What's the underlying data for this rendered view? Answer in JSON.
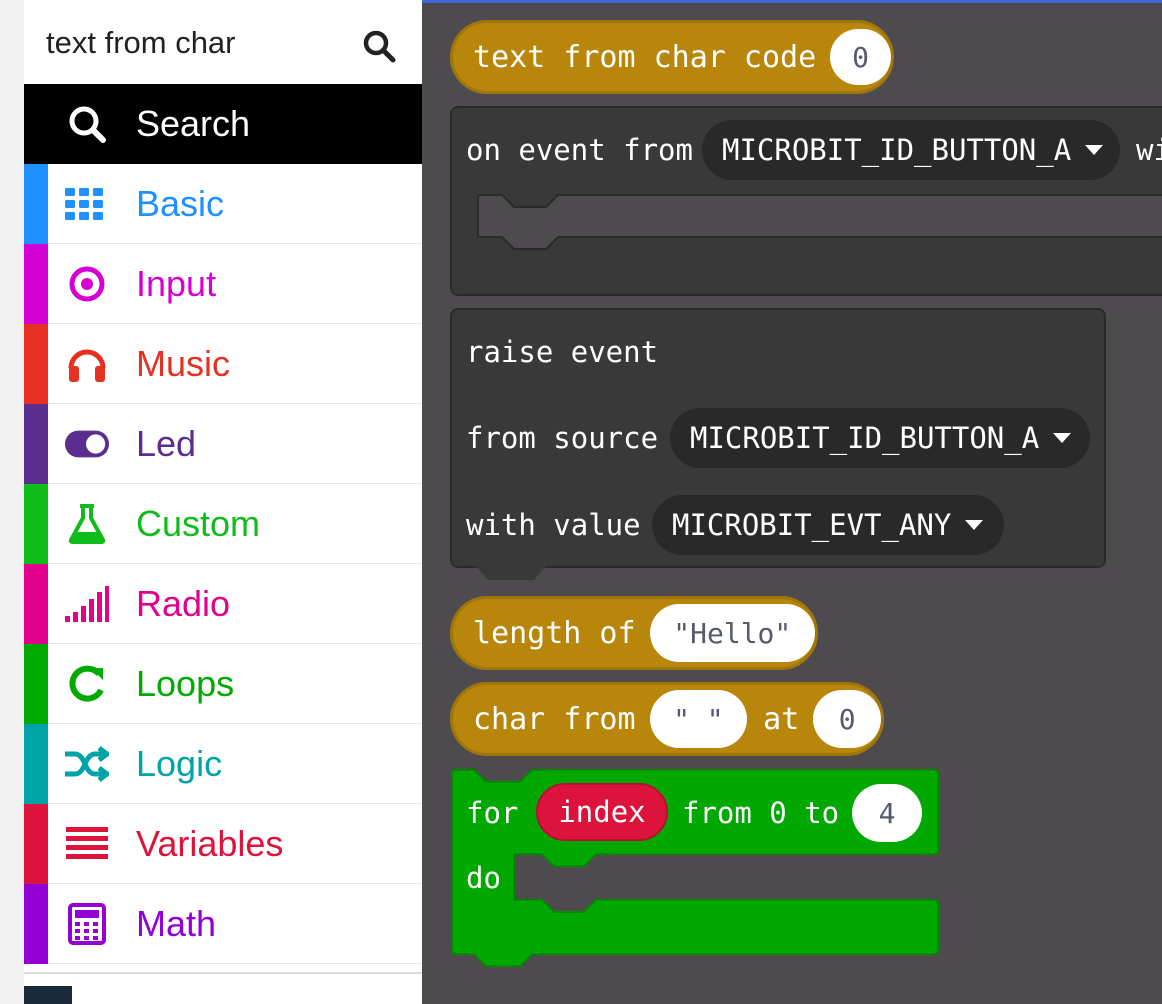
{
  "search": {
    "value": "text from char"
  },
  "categories": [
    {
      "label": "Search",
      "color": "#000000",
      "icon": "search-icon"
    },
    {
      "label": "Basic",
      "color": "#1e90ff",
      "icon": "grid-icon"
    },
    {
      "label": "Input",
      "color": "#d400d4",
      "icon": "target-icon"
    },
    {
      "label": "Music",
      "color": "#e63022",
      "icon": "headphones-icon"
    },
    {
      "label": "Led",
      "color": "#5c2d91",
      "icon": "toggle-icon"
    },
    {
      "label": "Custom",
      "color": "#0fbd1a",
      "icon": "flask-icon"
    },
    {
      "label": "Radio",
      "color": "#e3008c",
      "icon": "signal-icon"
    },
    {
      "label": "Loops",
      "color": "#00aa00",
      "icon": "refresh-icon"
    },
    {
      "label": "Logic",
      "color": "#00a4a6",
      "icon": "shuffle-icon"
    },
    {
      "label": "Variables",
      "color": "#dc143c",
      "icon": "list-icon"
    },
    {
      "label": "Math",
      "color": "#9400d3",
      "icon": "calculator-icon"
    }
  ],
  "blocks": {
    "text_from_char": {
      "label": "text from char code",
      "value": "0"
    },
    "on_event": {
      "label": "on event from",
      "source": "MICROBIT_ID_BUTTON_A",
      "trail": "wi"
    },
    "raise_event": {
      "title": "raise event",
      "source_label": "from source",
      "source": "MICROBIT_ID_BUTTON_A",
      "value_label": "with value",
      "value": "MICROBIT_EVT_ANY"
    },
    "length_of": {
      "label": "length of",
      "value": "\"Hello\""
    },
    "char_from": {
      "label": "char from",
      "text": "\" \"",
      "at_label": "at",
      "index": "0"
    },
    "for_loop": {
      "label": "for",
      "var": "index",
      "from_label": "from 0 to",
      "to": "4",
      "do_label": "do"
    }
  },
  "colors": {
    "text_block": "#b8860b",
    "loops": "#00a800",
    "variable": "#dc143c",
    "workspace": "#4d4b4d",
    "dark_block": "#3a393a"
  }
}
